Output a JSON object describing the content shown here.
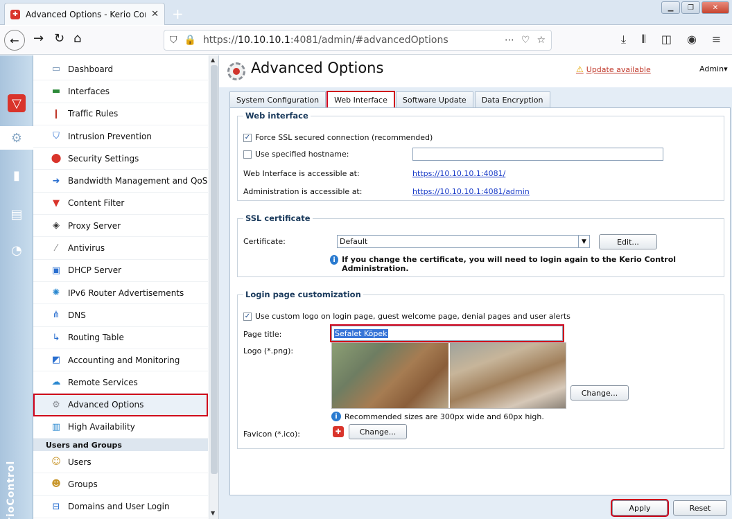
{
  "browser": {
    "tab_title": "Advanced Options - Kerio Cont",
    "url_prefix": "https://",
    "url_host": "10.10.10.1",
    "url_rest": ":4081/admin/#advancedOptions"
  },
  "rail": {
    "brand": "KerioControl"
  },
  "sidebar": {
    "items": [
      {
        "label": "Dashboard",
        "icon": "chart-icon"
      },
      {
        "label": "Interfaces",
        "icon": "network-icon"
      },
      {
        "label": "Traffic Rules",
        "icon": "traffic-light-icon"
      },
      {
        "label": "Intrusion Prevention",
        "icon": "shield-icon"
      },
      {
        "label": "Security Settings",
        "icon": "security-icon"
      },
      {
        "label": "Bandwidth Management and QoS",
        "icon": "arrow-icon"
      },
      {
        "label": "Content Filter",
        "icon": "filter-icon"
      },
      {
        "label": "Proxy Server",
        "icon": "proxy-icon"
      },
      {
        "label": "Antivirus",
        "icon": "syringe-icon"
      },
      {
        "label": "DHCP Server",
        "icon": "monitor-icon"
      },
      {
        "label": "IPv6 Router Advertisements",
        "icon": "ipv6-icon"
      },
      {
        "label": "DNS",
        "icon": "dns-icon"
      },
      {
        "label": "Routing Table",
        "icon": "routing-icon"
      },
      {
        "label": "Accounting and Monitoring",
        "icon": "accounting-icon"
      },
      {
        "label": "Remote Services",
        "icon": "cloud-icon"
      },
      {
        "label": "Advanced Options",
        "icon": "gear-icon"
      },
      {
        "label": "High Availability",
        "icon": "servers-icon"
      }
    ],
    "section_users": "Users and Groups",
    "user_items": [
      {
        "label": "Users",
        "icon": "user-icon"
      },
      {
        "label": "Groups",
        "icon": "group-icon"
      },
      {
        "label": "Domains and User Login",
        "icon": "domain-icon"
      }
    ]
  },
  "header": {
    "title": "Advanced Options",
    "update": "Update available",
    "admin": "Admin"
  },
  "tabs": [
    "System Configuration",
    "Web Interface",
    "Software Update",
    "Data Encryption"
  ],
  "web_interface": {
    "legend": "Web interface",
    "force_ssl": "Force SSL secured connection (recommended)",
    "use_hostname": "Use specified hostname:",
    "hostname_value": "",
    "web_access_label": "Web Interface is accessible at:",
    "web_access_url": "https://10.10.10.1:4081/",
    "admin_access_label": "Administration is accessible at:",
    "admin_access_url": "https://10.10.10.1:4081/admin"
  },
  "ssl": {
    "legend": "SSL certificate",
    "cert_label": "Certificate:",
    "cert_value": "Default",
    "edit": "Edit...",
    "note": "If you change the certificate, you will need to login again to the Kerio Control Administration."
  },
  "login": {
    "legend": "Login page customization",
    "custom_logo": "Use custom logo on login page, guest welcome page, denial pages and user alerts",
    "page_title_label": "Page title:",
    "page_title_value": "Sefalet Köpek",
    "logo_label": "Logo (*.png):",
    "change": "Change...",
    "recommend": "Recommended sizes are 300px wide and 60px high.",
    "favicon_label": "Favicon (*.ico):",
    "favicon_change": "Change..."
  },
  "footer": {
    "apply": "Apply",
    "reset": "Reset"
  }
}
